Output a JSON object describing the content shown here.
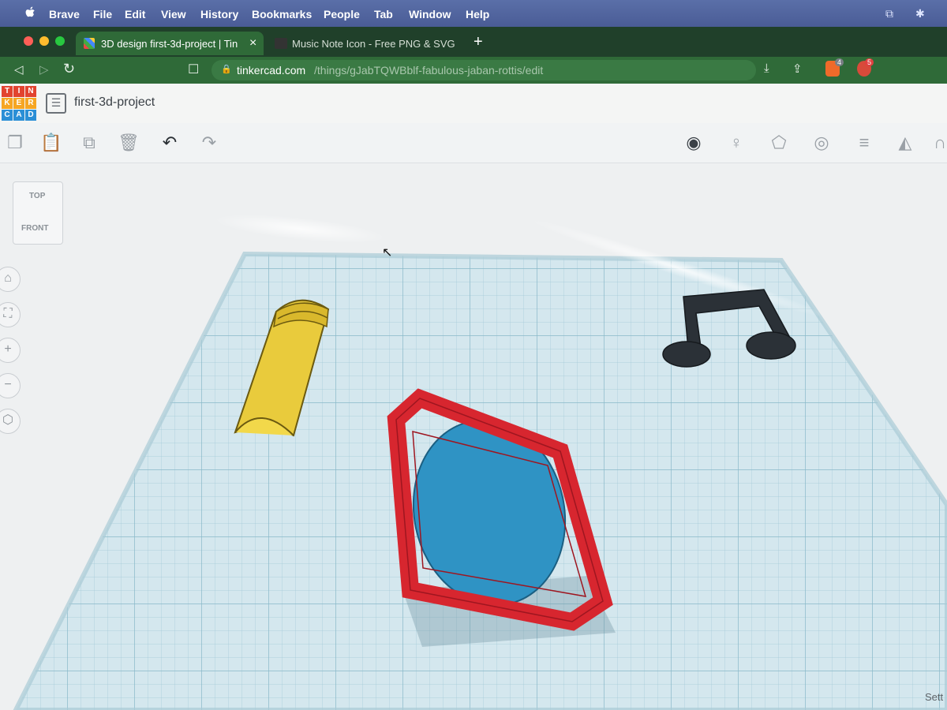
{
  "menubar": {
    "apple": "",
    "items": [
      "Brave",
      "File",
      "Edit",
      "View",
      "History",
      "Bookmarks",
      "People",
      "Tab",
      "Window",
      "Help"
    ]
  },
  "tabs": [
    {
      "title": "3D design first-3d-project | Tin",
      "close": "×",
      "active": true
    },
    {
      "title": "Music Note Icon - Free PNG & SVG",
      "active": false
    }
  ],
  "new_tab": "+",
  "address": {
    "domain": "tinkercad.com",
    "path": "/things/gJabTQWBblf-fabulous-jaban-rottis/edit",
    "shield_badge": "4",
    "rewards_badge": "5"
  },
  "tinkercad": {
    "logo_rows": [
      [
        "T",
        "I",
        "N"
      ],
      [
        "K",
        "E",
        "R"
      ],
      [
        "C",
        "A",
        "D"
      ]
    ],
    "project_name": "first-3d-project"
  },
  "viewcube": {
    "top": "TOP",
    "front": "FRONT"
  },
  "settings_label": "Sett",
  "colors": {
    "workplane": "#cfe3ea",
    "grid": "#8fbccb",
    "cylinder": "#e8c93a",
    "frame": "#e0262e",
    "disc": "#2b8fc0",
    "note": "#2a3138"
  }
}
